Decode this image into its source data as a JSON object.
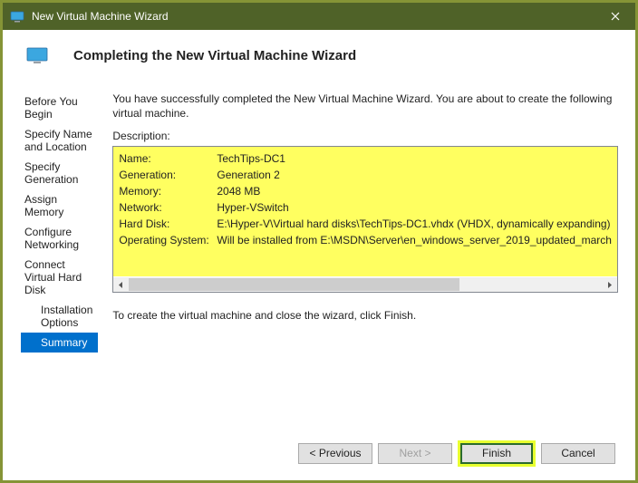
{
  "window": {
    "title": "New Virtual Machine Wizard"
  },
  "header": {
    "title": "Completing the New Virtual Machine Wizard"
  },
  "nav": {
    "items": [
      {
        "label": "Before You Begin"
      },
      {
        "label": "Specify Name and Location"
      },
      {
        "label": "Specify Generation"
      },
      {
        "label": "Assign Memory"
      },
      {
        "label": "Configure Networking"
      },
      {
        "label": "Connect Virtual Hard Disk"
      },
      {
        "label": "Installation Options"
      },
      {
        "label": "Summary"
      }
    ]
  },
  "content": {
    "intro": "You have successfully completed the New Virtual Machine Wizard. You are about to create the following virtual machine.",
    "desc_label": "Description:",
    "rows": [
      {
        "key": "Name:",
        "val": "TechTips-DC1"
      },
      {
        "key": "Generation:",
        "val": "Generation 2"
      },
      {
        "key": "Memory:",
        "val": "2048 MB"
      },
      {
        "key": "Network:",
        "val": "Hyper-VSwitch"
      },
      {
        "key": "Hard Disk:",
        "val": "E:\\Hyper-V\\Virtual hard disks\\TechTips-DC1.vhdx (VHDX, dynamically expanding)"
      },
      {
        "key": "Operating System:",
        "val": "Will be installed from E:\\MSDN\\Server\\en_windows_server_2019_updated_march"
      }
    ],
    "finish_text": "To create the virtual machine and close the wizard, click Finish."
  },
  "footer": {
    "previous": "< Previous",
    "next": "Next >",
    "finish": "Finish",
    "cancel": "Cancel"
  }
}
